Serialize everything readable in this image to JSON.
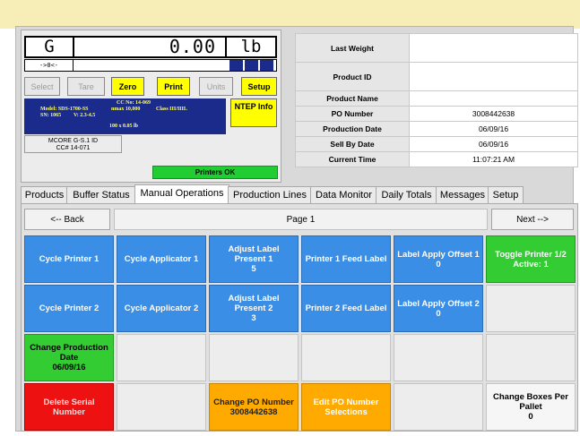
{
  "scale": {
    "mode": "G",
    "weight": "0.00",
    "unit": "lb",
    "zero_indicator": "->0<-",
    "buttons": [
      "Select",
      "Tare",
      "Zero",
      "Print",
      "Units",
      "Setup"
    ],
    "info_lines": [
      "CC No: 14-069",
      "Model: SDS-1700-SS",
      "nmax 10,000",
      "Class III/IIIL",
      "SN: 1065",
      "V: 2.3-4.5",
      "100 x 0.05 lb"
    ],
    "ntep": "NTEP Info",
    "mcore": "MCORE G-S.1 ID",
    "mcore_cc": "CC# 14-071",
    "printers_status": "Printers OK"
  },
  "info": [
    {
      "label": "Last Weight",
      "value": ""
    },
    {
      "label": "Product ID",
      "value": ""
    },
    {
      "label": "Product Name",
      "value": ""
    },
    {
      "label": "PO Number",
      "value": "3008442638"
    },
    {
      "label": "Production Date",
      "value": "06/09/16"
    },
    {
      "label": "Sell By Date",
      "value": "06/09/16"
    },
    {
      "label": "Current Time",
      "value": "11:07:21 AM"
    }
  ],
  "tabs": [
    "Products",
    "Buffer Status",
    "Manual Operations",
    "Production Lines",
    "Data Monitor",
    "Daily Totals",
    "Messages",
    "Setup"
  ],
  "active_tab": "Manual Operations",
  "nav": {
    "back": "<-- Back",
    "page": "Page 1",
    "next": "Next -->"
  },
  "grid": [
    [
      "Cycle Printer 1",
      "Cycle Applicator 1",
      "Adjust Label Present 1",
      "5",
      "Printer 1 Feed Label",
      "Label Apply Offset 1",
      "0",
      "Toggle Printer 1/2",
      "Active: 1"
    ],
    [
      "Cycle Printer 2",
      "Cycle Applicator 2",
      "Adjust Label Present 2",
      "3",
      "Printer 2 Feed Label",
      "Label Apply Offset 2",
      "0"
    ],
    [
      "Change Production Date",
      "06/09/16"
    ],
    [
      "Delete Serial Number",
      "Change PO Number",
      "3008442638",
      "Edit PO Number Selections",
      "Change Boxes Per Pallet",
      "0"
    ]
  ],
  "colors": {
    "blue": "#3a8ee6",
    "green": "#33cc33",
    "red": "#ee1111",
    "orange": "#ffaa00",
    "yellow": "#ffff00",
    "navy": "#1a2b8c"
  }
}
